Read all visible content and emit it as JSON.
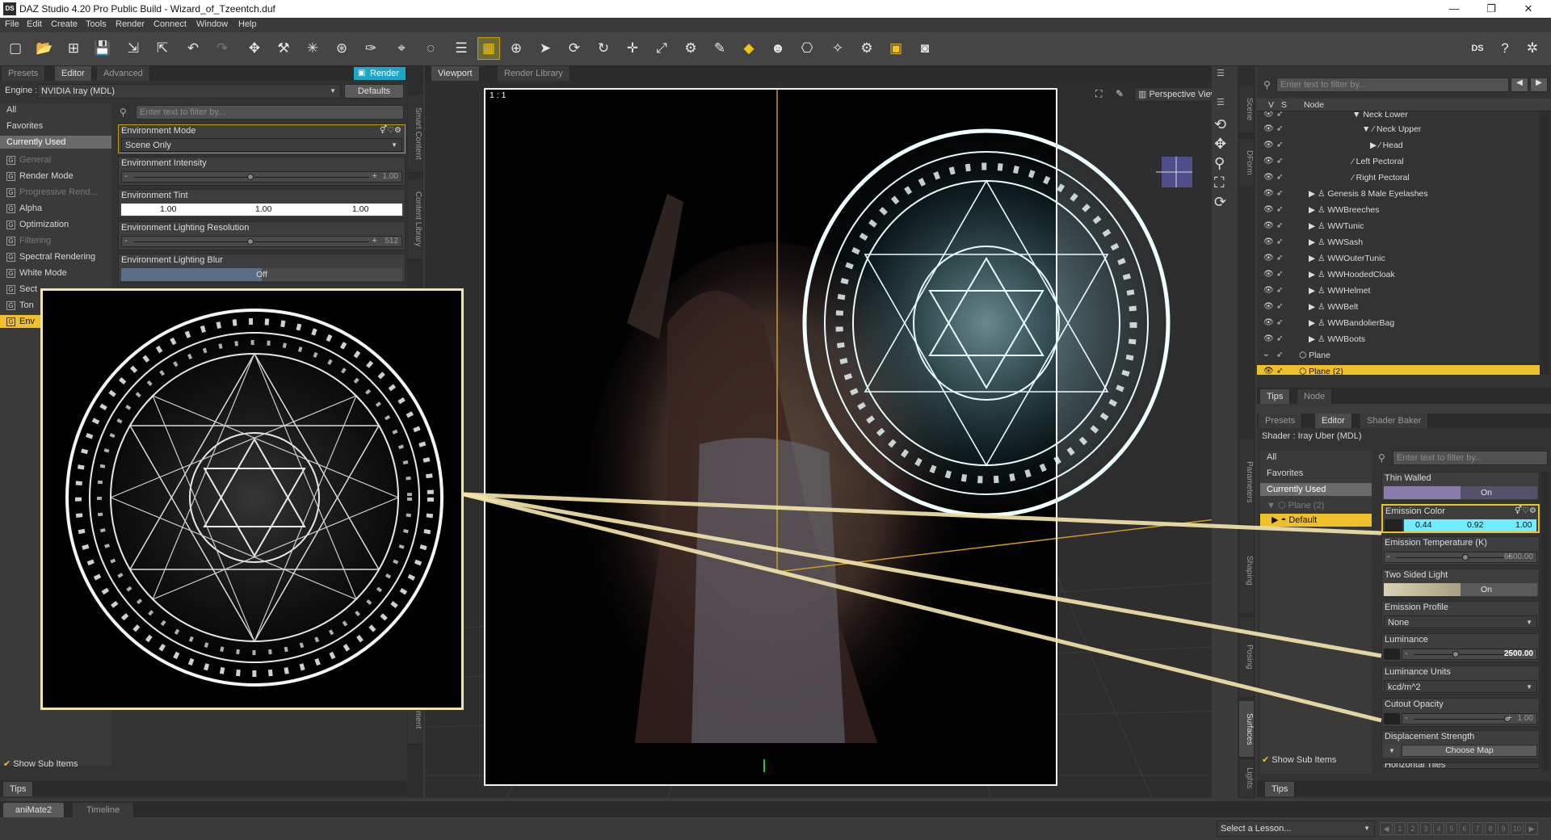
{
  "window": {
    "app_icon": "DS",
    "title": "DAZ Studio 4.20 Pro Public Build - Wizard_of_Tzeentch.duf",
    "controls": [
      "—",
      "❐",
      "✕"
    ]
  },
  "menu": [
    "File",
    "Edit",
    "Create",
    "Tools",
    "Render",
    "Connect",
    "Window",
    "Help"
  ],
  "toolbar": {
    "icons": [
      "new-icon",
      "open-icon",
      "merge-icon",
      "save-icon",
      "import-icon",
      "export-icon",
      "undo-icon",
      "redo-icon",
      "universal-tool-icon",
      "joint-editor-icon",
      "spot-render-icon",
      "geometry-editor-icon",
      "node-weight-icon",
      "transform-icon",
      "rotate-icon",
      "align-icon",
      "region-icon",
      "active-pose-icon",
      "pointer-icon",
      "orbit-icon",
      "rotate-view-icon",
      "translate-icon",
      "scale-icon",
      "node-tool-icon",
      "surface-selection-icon",
      "surface-editor-icon",
      "figure-setup-icon",
      "camera-tool-icon",
      "iray-preview-icon",
      "render-settings-icon",
      "render-icon",
      "render-camera-icon"
    ],
    "right_icons": [
      "ds-icon",
      "help-icon",
      "settings-icon"
    ]
  },
  "render_settings": {
    "tabs": [
      "Presets",
      "Editor",
      "Advanced"
    ],
    "render_button": "Render",
    "engine_label": "Engine :",
    "engine_value": "NVIDIA Iray (MDL)",
    "defaults_button": "Defaults",
    "filter_placeholder": "Enter text to filter by...",
    "categories": [
      {
        "label": "All",
        "state": "normal"
      },
      {
        "label": "Favorites",
        "state": "normal"
      },
      {
        "label": "Currently Used",
        "state": "selected"
      },
      {
        "label": "General",
        "state": "dim",
        "group": true
      },
      {
        "label": "Render Mode",
        "state": "normal",
        "group": true
      },
      {
        "label": "Progressive Rend...",
        "state": "dim",
        "group": true
      },
      {
        "label": "Alpha",
        "state": "normal",
        "group": true
      },
      {
        "label": "Optimization",
        "state": "normal",
        "group": true
      },
      {
        "label": "Filtering",
        "state": "dim",
        "group": true
      },
      {
        "label": "Spectral Rendering",
        "state": "normal",
        "group": true
      },
      {
        "label": "White Mode",
        "state": "normal",
        "group": true
      },
      {
        "label": "Sect",
        "state": "normal",
        "group": true
      },
      {
        "label": "Ton",
        "state": "normal",
        "group": true
      },
      {
        "label": "Env",
        "state": "active",
        "group": true
      }
    ],
    "properties": {
      "env_mode_label": "Environment Mode",
      "env_mode_value": "Scene Only",
      "env_intensity_label": "Environment Intensity",
      "env_intensity_value": "1.00",
      "env_intensity_fraction": 0.5,
      "env_tint_label": "Environment Tint",
      "env_tint_values": [
        "1.00",
        "1.00",
        "1.00"
      ],
      "env_res_label": "Environment Lighting Resolution",
      "env_res_value": "512",
      "env_res_fraction": 0.5,
      "env_blur_label": "Environment Lighting Blur",
      "env_blur_value": "Off"
    },
    "show_sub_items": "Show Sub Items",
    "tips_tab": "Tips"
  },
  "side_tabs_left": [
    "Smart Content",
    "Content Library"
  ],
  "side_tabs_left_bottom": "ment",
  "viewport": {
    "tabs": [
      "Viewport",
      "Render Library"
    ],
    "ratio": "1 : 1",
    "camera": "Perspective View"
  },
  "scene": {
    "filter_placeholder": "Enter text to filter by...",
    "col_v": "V",
    "col_s": "S",
    "col_node": "Node",
    "side_tabs": [
      "Scene",
      "DForm"
    ],
    "rows": [
      {
        "label": "Neck Lower",
        "indent": 6,
        "expander": "▼"
      },
      {
        "label": "Neck Upper",
        "indent": 7,
        "expander": "▼"
      },
      {
        "label": "Head",
        "indent": 8,
        "expander": "▶"
      },
      {
        "label": "Left Pectoral",
        "indent": 6,
        "expander": ""
      },
      {
        "label": "Right Pectoral",
        "indent": 6,
        "expander": ""
      },
      {
        "label": "Genesis 8 Male Eyelashes",
        "indent": 3,
        "expander": "▶"
      },
      {
        "label": "WWBreeches",
        "indent": 3,
        "expander": "▶"
      },
      {
        "label": "WWTunic",
        "indent": 3,
        "expander": "▶"
      },
      {
        "label": "WWSash",
        "indent": 3,
        "expander": "▶"
      },
      {
        "label": "WWOuterTunic",
        "indent": 3,
        "expander": "▶"
      },
      {
        "label": "WWHoodedCloak",
        "indent": 3,
        "expander": "▶"
      },
      {
        "label": "WWHelmet",
        "indent": 3,
        "expander": "▶"
      },
      {
        "label": "WWBelt",
        "indent": 3,
        "expander": "▶"
      },
      {
        "label": "WWBandolierBag",
        "indent": 3,
        "expander": "▶"
      },
      {
        "label": "WWBoots",
        "indent": 3,
        "expander": "▶"
      },
      {
        "label": "Plane",
        "indent": 2,
        "expander": ""
      },
      {
        "label": "Plane (2)",
        "indent": 2,
        "expander": "",
        "selected": true
      }
    ],
    "bottom_tabs": [
      "Tips",
      "Node"
    ]
  },
  "surfaces": {
    "tabs": [
      "Presets",
      "Editor",
      "Shader Baker"
    ],
    "shader_label": "Shader : Iray Uber (MDL)",
    "side_tabs": [
      "Parameters",
      "Shaping",
      "Posing",
      "Surfaces",
      "Lights"
    ],
    "filter_placeholder": "Enter text to filter by...",
    "categories": [
      "All",
      "Favorites",
      "Currently Used"
    ],
    "tree_parent": "Plane (2)",
    "tree_child": "Default",
    "props": {
      "thin_walled_label": "Thin Walled",
      "thin_walled_value": "On",
      "emission_color_label": "Emission Color",
      "emission_color_values": [
        "0.44",
        "0.92",
        "1.00"
      ],
      "emission_temp_label": "Emission Temperature (K)",
      "emission_temp_value": "6500.00",
      "emission_temp_fraction": 0.7,
      "two_sided_label": "Two Sided Light",
      "two_sided_value": "On",
      "emission_profile_label": "Emission Profile",
      "emission_profile_value": "None",
      "luminance_label": "Luminance",
      "luminance_value": "2500.00",
      "luminance_fraction": 0.55,
      "lum_units_label": "Luminance Units",
      "lum_units_value": "kcd/m^2",
      "cutout_label": "Cutout Opacity",
      "cutout_value": "1.00",
      "cutout_fraction": 1.0,
      "displacement_label": "Displacement Strength",
      "choose_map": "Choose Map",
      "horizontal_tiles": "Horizontal Tiles"
    },
    "show_sub_items": "Show Sub Items",
    "tips_tab": "Tips"
  },
  "bottom": {
    "tabs": [
      "aniMate2",
      "Timeline"
    ],
    "lesson_placeholder": "Select a Lesson...",
    "pager": [
      "1",
      "2",
      "3",
      "4",
      "5",
      "6",
      "7",
      "8",
      "9",
      "10"
    ]
  },
  "colors": {
    "accent": "#f0c02a",
    "render_button": "#1ea6c8",
    "emission_color": "#70ebff",
    "callout_line": "#f2e3a8"
  }
}
